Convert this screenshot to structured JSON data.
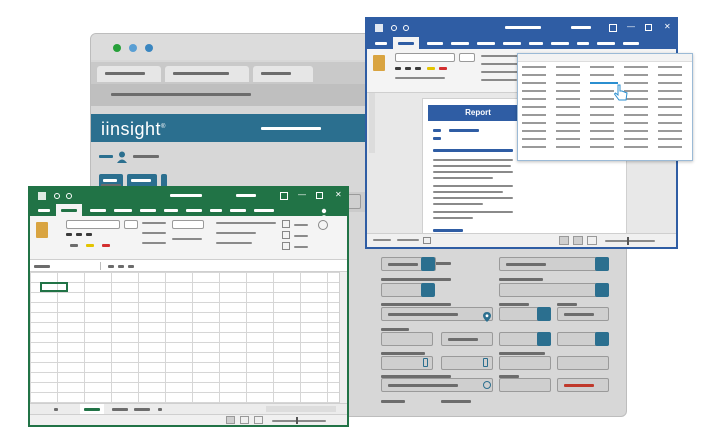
{
  "brand": {
    "name": "iinsight",
    "mark": "®"
  },
  "word": {
    "report_title": "Report"
  },
  "colors": {
    "excel_green": "#217346",
    "word_blue": "#2f5da4",
    "app_teal": "#2b6f8f",
    "app_gray": "#d7d7d7"
  },
  "icons": {
    "user": "user-icon",
    "search": "search-icon",
    "close": "close-icon",
    "dropdown": "chevron-down-icon",
    "location": "location-pin-icon",
    "phone": "phone-icon",
    "cursor": "hand-cursor-icon"
  }
}
